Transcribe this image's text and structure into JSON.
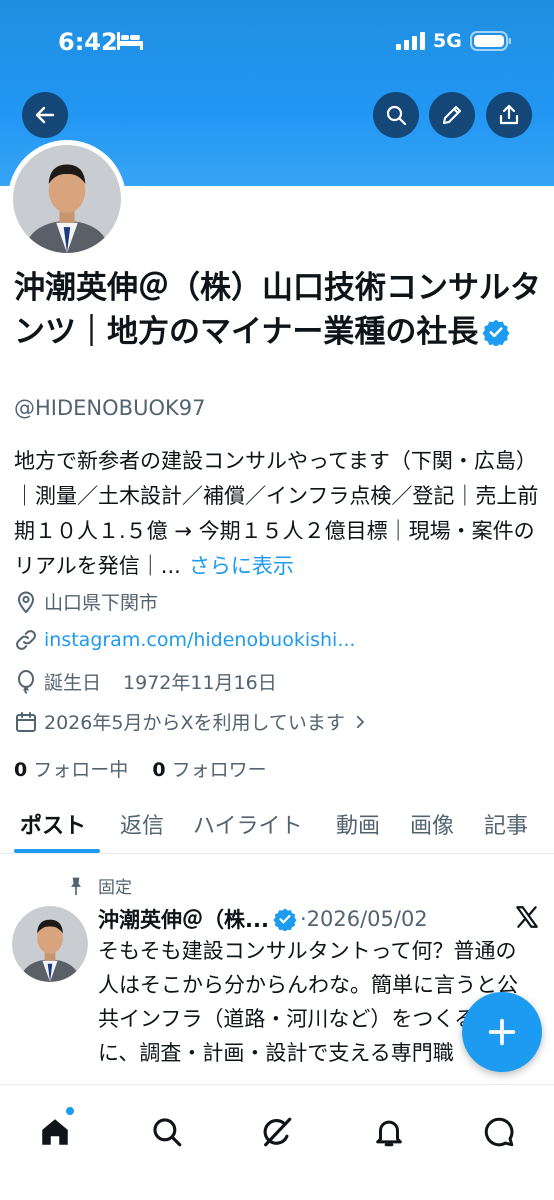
{
  "status_bar": {
    "time": "6:42",
    "network": "5G"
  },
  "profile": {
    "name": "沖潮英伸＠（株）山口技術コンサルタンツ｜地方のマイナー業種の社長",
    "handle": "@HIDENOBUOK97",
    "bio": "地方で新参者の建設コンサルやってます（下関・広島）｜測量／土木設計／補償／インフラ点検／登記｜売上前期１０人１.５億 → 今期１５人２億目標｜現場・案件のリアルを発信｜...",
    "bio_more": "さらに表示",
    "location": "山口県下関市",
    "link": "instagram.com/hidenobuokishi...",
    "birthday_label": "誕生日",
    "birthday": "1972年11月16日",
    "joined": "2026年5月からXを利用しています",
    "following_count": "0",
    "following_label": "フォロー中",
    "followers_count": "0",
    "followers_label": "フォロワー"
  },
  "tabs": [
    "ポスト",
    "返信",
    "ハイライト",
    "動画",
    "画像",
    "記事"
  ],
  "pinned_post": {
    "pinned_label": "固定",
    "author": "沖潮英伸＠（株...",
    "separator": "·",
    "date": "2026/05/02",
    "text": "そもそも建設コンサルタントって何？普通の人はそこから分からんわな。簡単に言うと公共インフラ（道路・河川など）をつくる前に、調査・計画・設計で支える専門職"
  },
  "colors": {
    "accent": "#1d9bf0",
    "banner": "#2196f3",
    "text": "#0f1419",
    "muted": "#536471"
  },
  "icons": {
    "back": "arrow-left-icon",
    "search": "search-icon",
    "edit": "pencil-icon",
    "share": "share-icon",
    "location": "location-pin-icon",
    "link": "link-icon",
    "birthday": "balloon-icon",
    "calendar": "calendar-icon",
    "pin": "pin-icon",
    "compose": "plus-icon",
    "nav": [
      "home-icon",
      "search-icon",
      "grok-icon",
      "bell-icon",
      "message-icon"
    ]
  }
}
